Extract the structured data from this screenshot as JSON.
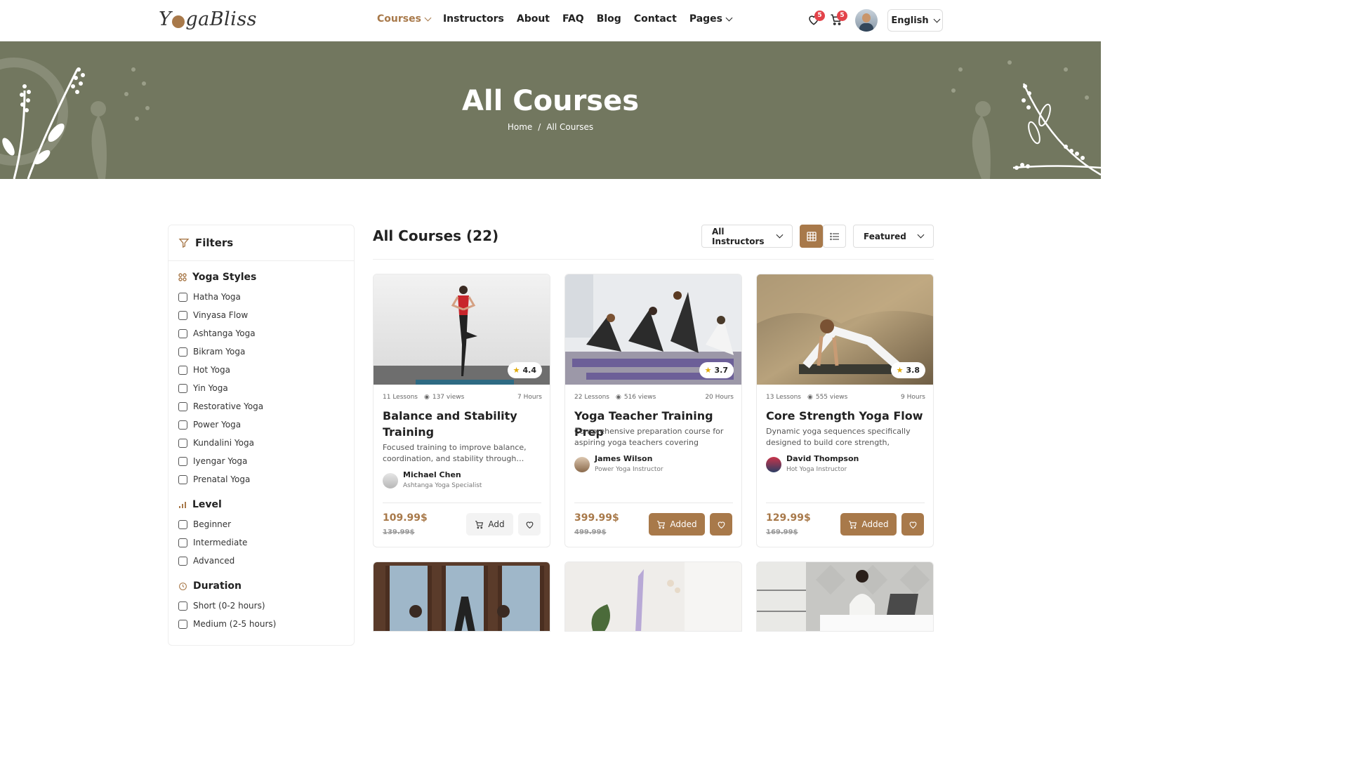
{
  "brand": {
    "logo_pre": "Y",
    "logo_post": "gaBliss"
  },
  "nav": [
    {
      "label": "Courses",
      "active": true,
      "dropdown": true
    },
    {
      "label": "Instructors"
    },
    {
      "label": "About"
    },
    {
      "label": "FAQ"
    },
    {
      "label": "Blog"
    },
    {
      "label": "Contact"
    },
    {
      "label": "Pages",
      "dropdown": true
    }
  ],
  "header": {
    "wishlist_count": "5",
    "cart_count": "5",
    "language": "English"
  },
  "hero": {
    "title": "All Courses",
    "crumb_home": "Home",
    "crumb_sep": "/",
    "crumb_current": "All Courses"
  },
  "filters": {
    "title": "Filters",
    "styles_title": "Yoga Styles",
    "styles": [
      "Hatha Yoga",
      "Vinyasa Flow",
      "Ashtanga Yoga",
      "Bikram Yoga",
      "Hot Yoga",
      "Yin Yoga",
      "Restorative Yoga",
      "Power Yoga",
      "Kundalini Yoga",
      "Iyengar Yoga",
      "Prenatal Yoga"
    ],
    "level_title": "Level",
    "levels": [
      "Beginner",
      "Intermediate",
      "Advanced"
    ],
    "duration_title": "Duration",
    "durations": [
      "Short (0-2 hours)",
      "Medium (2-5 hours)"
    ]
  },
  "main": {
    "title": "All Courses (22)",
    "instructor_filter": "All Instructors",
    "sort": "Featured",
    "view_mode": "grid"
  },
  "colors": {
    "accent": "#a8794a",
    "hero_bg": "#72775f"
  },
  "courses": [
    {
      "lessons": "11 Lessons",
      "views": "137 views",
      "hours": "7 Hours",
      "rating": "4.4",
      "title": "Balance and Stability Training",
      "desc": "Focused training to improve balance, coordination, and stability through…",
      "instructor": "Michael Chen",
      "role": "Ashtanga Yoga Specialist",
      "price": "109.99$",
      "old_price": "139.99$",
      "cart_label": "Add",
      "in_cart": false,
      "wishlisted": false
    },
    {
      "lessons": "22 Lessons",
      "views": "516 views",
      "hours": "20 Hours",
      "rating": "3.7",
      "title": "Yoga Teacher Training Prep",
      "desc": "Comprehensive preparation course for aspiring yoga teachers covering anatomy,…",
      "instructor": "James Wilson",
      "role": "Power Yoga Instructor",
      "price": "399.99$",
      "old_price": "499.99$",
      "cart_label": "Added",
      "in_cart": true,
      "wishlisted": true
    },
    {
      "lessons": "13 Lessons",
      "views": "555 views",
      "hours": "9 Hours",
      "rating": "3.8",
      "title": "Core Strength Yoga Flow",
      "desc": "Dynamic yoga sequences specifically designed to build core strength, stability,…",
      "instructor": "David Thompson",
      "role": "Hot Yoga Instructor",
      "price": "129.99$",
      "old_price": "169.99$",
      "cart_label": "Added",
      "in_cart": true,
      "wishlisted": true
    }
  ]
}
